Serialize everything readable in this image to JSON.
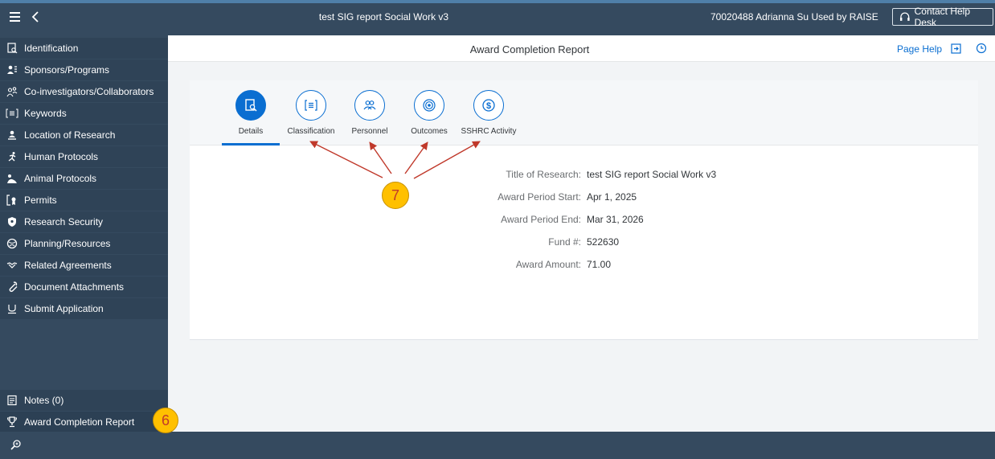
{
  "shell": {
    "title": "test SIG report Social Work v3",
    "user": "70020488  Adrianna Su Used by RAISE",
    "help_button": "Contact Help Desk"
  },
  "sidebar": {
    "items": [
      {
        "label": "Identification",
        "icon": "report-icon"
      },
      {
        "label": "Sponsors/Programs",
        "icon": "sponsor-icon"
      },
      {
        "label": "Co-investigators/Collaborators",
        "icon": "group-icon"
      },
      {
        "label": "Keywords",
        "icon": "list-icon"
      },
      {
        "label": "Location of Research",
        "icon": "location-person-icon"
      },
      {
        "label": "Human Protocols",
        "icon": "running-person-icon"
      },
      {
        "label": "Animal Protocols",
        "icon": "animal-icon"
      },
      {
        "label": "Permits",
        "icon": "permit-icon"
      },
      {
        "label": "Research Security",
        "icon": "shield-icon"
      },
      {
        "label": "Planning/Resources",
        "icon": "globe-icon"
      },
      {
        "label": "Related Agreements",
        "icon": "handshake-icon"
      },
      {
        "label": "Document Attachments",
        "icon": "paperclip-icon"
      },
      {
        "label": "Submit Application",
        "icon": "submit-icon"
      }
    ],
    "bottom_items": [
      {
        "label": "Notes (0)",
        "icon": "note-icon"
      },
      {
        "label": "Award Completion Report",
        "icon": "trophy-icon"
      }
    ]
  },
  "page": {
    "title": "Award Completion Report",
    "help_link": "Page Help"
  },
  "tabs": [
    {
      "label": "Details",
      "icon": "details-icon",
      "active": true
    },
    {
      "label": "Classification",
      "icon": "list-icon",
      "active": false
    },
    {
      "label": "Personnel",
      "icon": "personnel-icon",
      "active": false
    },
    {
      "label": "Outcomes",
      "icon": "target-icon",
      "active": false
    },
    {
      "label": "SSHRC Activity",
      "icon": "dollar-icon",
      "active": false
    }
  ],
  "details": {
    "title_label": "Title of Research:",
    "title_value": "test SIG report Social Work v3",
    "start_label": "Award Period Start:",
    "start_value": "Apr 1, 2025",
    "end_label": "Award Period End:",
    "end_value": "Mar 31, 2026",
    "fund_label": "Fund #:",
    "fund_value": "522630",
    "amount_label": "Award Amount:",
    "amount_value": "71.00"
  },
  "callouts": {
    "tabs_step": "7",
    "sidebar_step": "6"
  },
  "colors": {
    "shell": "#354a5f",
    "accent_blue": "#0a6ed1",
    "badge": "#ffc000",
    "arrow": "#c0392b"
  }
}
